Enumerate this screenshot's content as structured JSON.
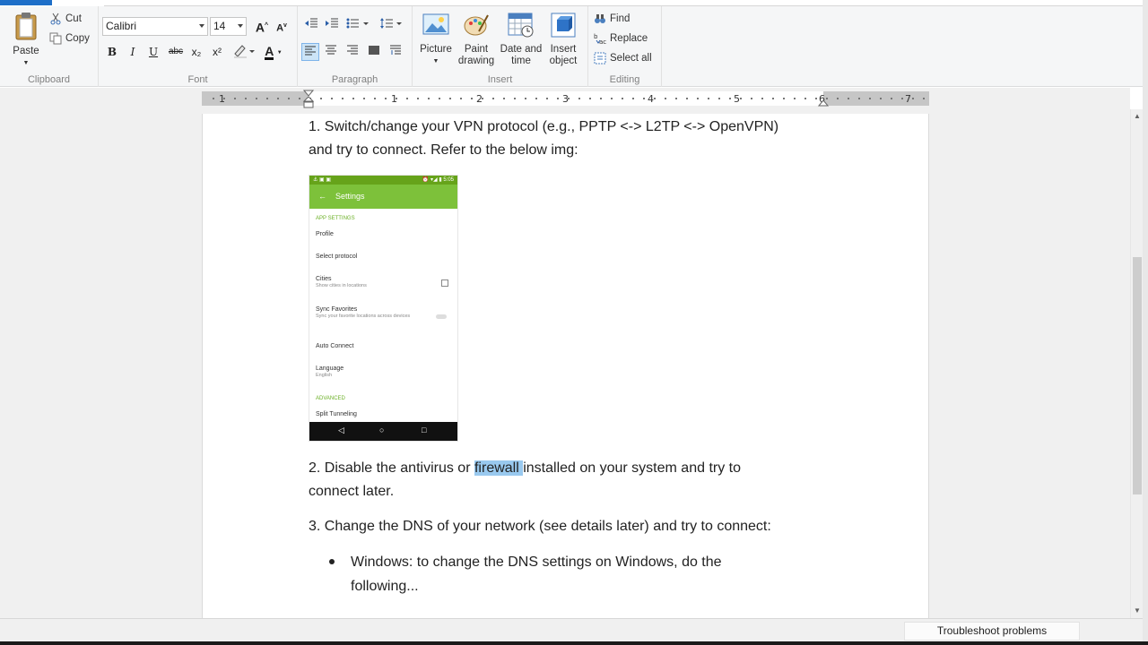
{
  "clipboard": {
    "label": "Clipboard",
    "paste": "Paste",
    "cut": "Cut",
    "copy": "Copy"
  },
  "font": {
    "label": "Font",
    "family": "Calibri",
    "size": "14",
    "grow": "A",
    "shrink": "A",
    "bold": "B",
    "italic": "I",
    "underline": "U",
    "strike": "abc",
    "subscript": "x₂",
    "superscript": "x²",
    "color_glyph": "A"
  },
  "paragraph": {
    "label": "Paragraph"
  },
  "insert": {
    "label": "Insert",
    "picture": "Picture",
    "paint_line1": "Paint",
    "paint_line2": "drawing",
    "date_line1": "Date and",
    "date_line2": "time",
    "object_line1": "Insert",
    "object_line2": "object"
  },
  "editing": {
    "label": "Editing",
    "find": "Find",
    "replace": "Replace",
    "select_all": "Select all"
  },
  "ruler": {
    "numbers": [
      "1",
      "1",
      "2",
      "3",
      "4",
      "5",
      "6",
      "7"
    ]
  },
  "document": {
    "line1": "1. Switch/change your VPN protocol (e.g., PPTP <-> L2TP <-> OpenVPN)",
    "line2": "and try to connect. Refer to the below img:",
    "p2_before": "2. Disable the antivirus or ",
    "p2_highlight": "firewall ",
    "p2_after": "installed on your system and try to",
    "p2_line2": "connect later.",
    "p3": "3. Change the DNS of your network (see details later) and try to connect:",
    "bullet1_line1": "Windows: to change the DNS settings on Windows, do the",
    "bullet1_line2": "following..."
  },
  "phone": {
    "time": "5:05",
    "title": "Settings",
    "back": "←",
    "section1": "APP SETTINGS",
    "profile": "Profile",
    "protocol": "Select protocol",
    "cities": "Cities",
    "cities_sub": "Show cities in locations",
    "sync": "Sync Favorites",
    "sync_sub": "Sync your favorite locations across devices",
    "auto": "Auto Connect",
    "language": "Language",
    "language_sub": "English",
    "section2": "ADVANCED",
    "split": "Split Tunneling",
    "nav_back": "◁",
    "nav_home": "○",
    "nav_recent": "□"
  },
  "statusbar": {
    "troubleshoot": "Troubleshoot problems"
  },
  "colors": {
    "accent": "#1e6fc8",
    "selection": "#99c9ef",
    "phone_green": "#7dc13a"
  }
}
